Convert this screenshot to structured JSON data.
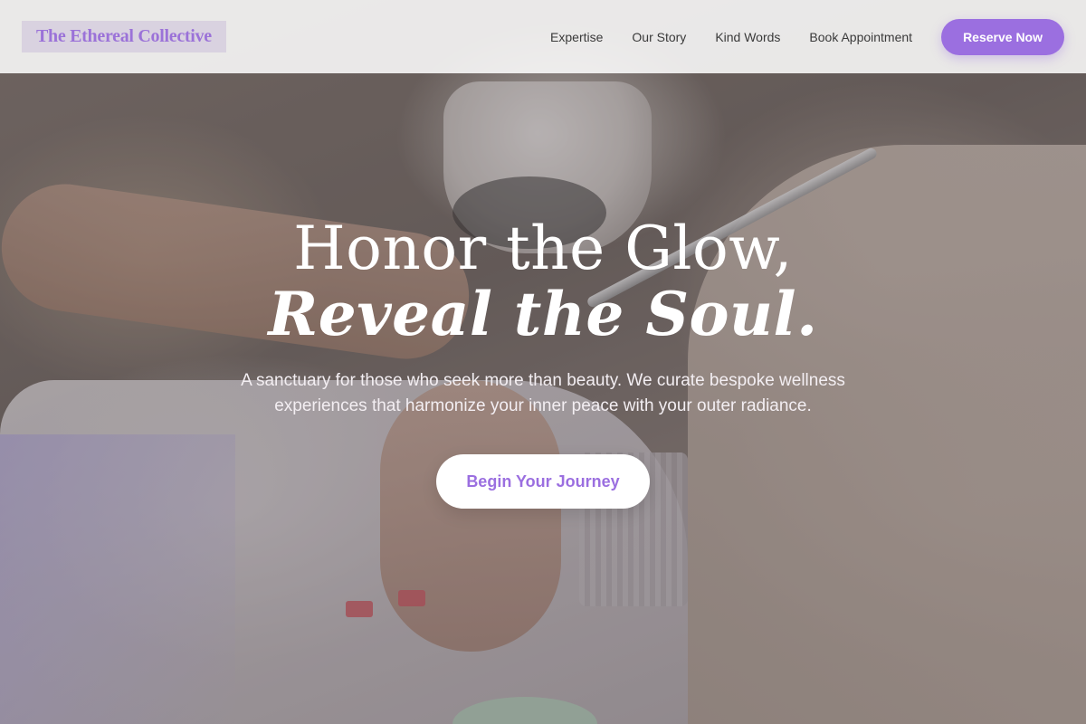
{
  "brand": {
    "name": "The Ethereal Collective",
    "accent_color": "#9b6fe0"
  },
  "nav": {
    "links": [
      "Expertise",
      "Our Story",
      "Kind Words",
      "Book Appointment"
    ],
    "cta_label": "Reserve Now"
  },
  "hero": {
    "headline_line1": "Honor the Glow,",
    "headline_line2": "Reveal the Soul.",
    "subtitle": "A sanctuary for those who seek more than beauty. We curate bespoke wellness experiences that harmonize your inner peace with your outer radiance.",
    "button_label": "Begin Your Journey"
  }
}
